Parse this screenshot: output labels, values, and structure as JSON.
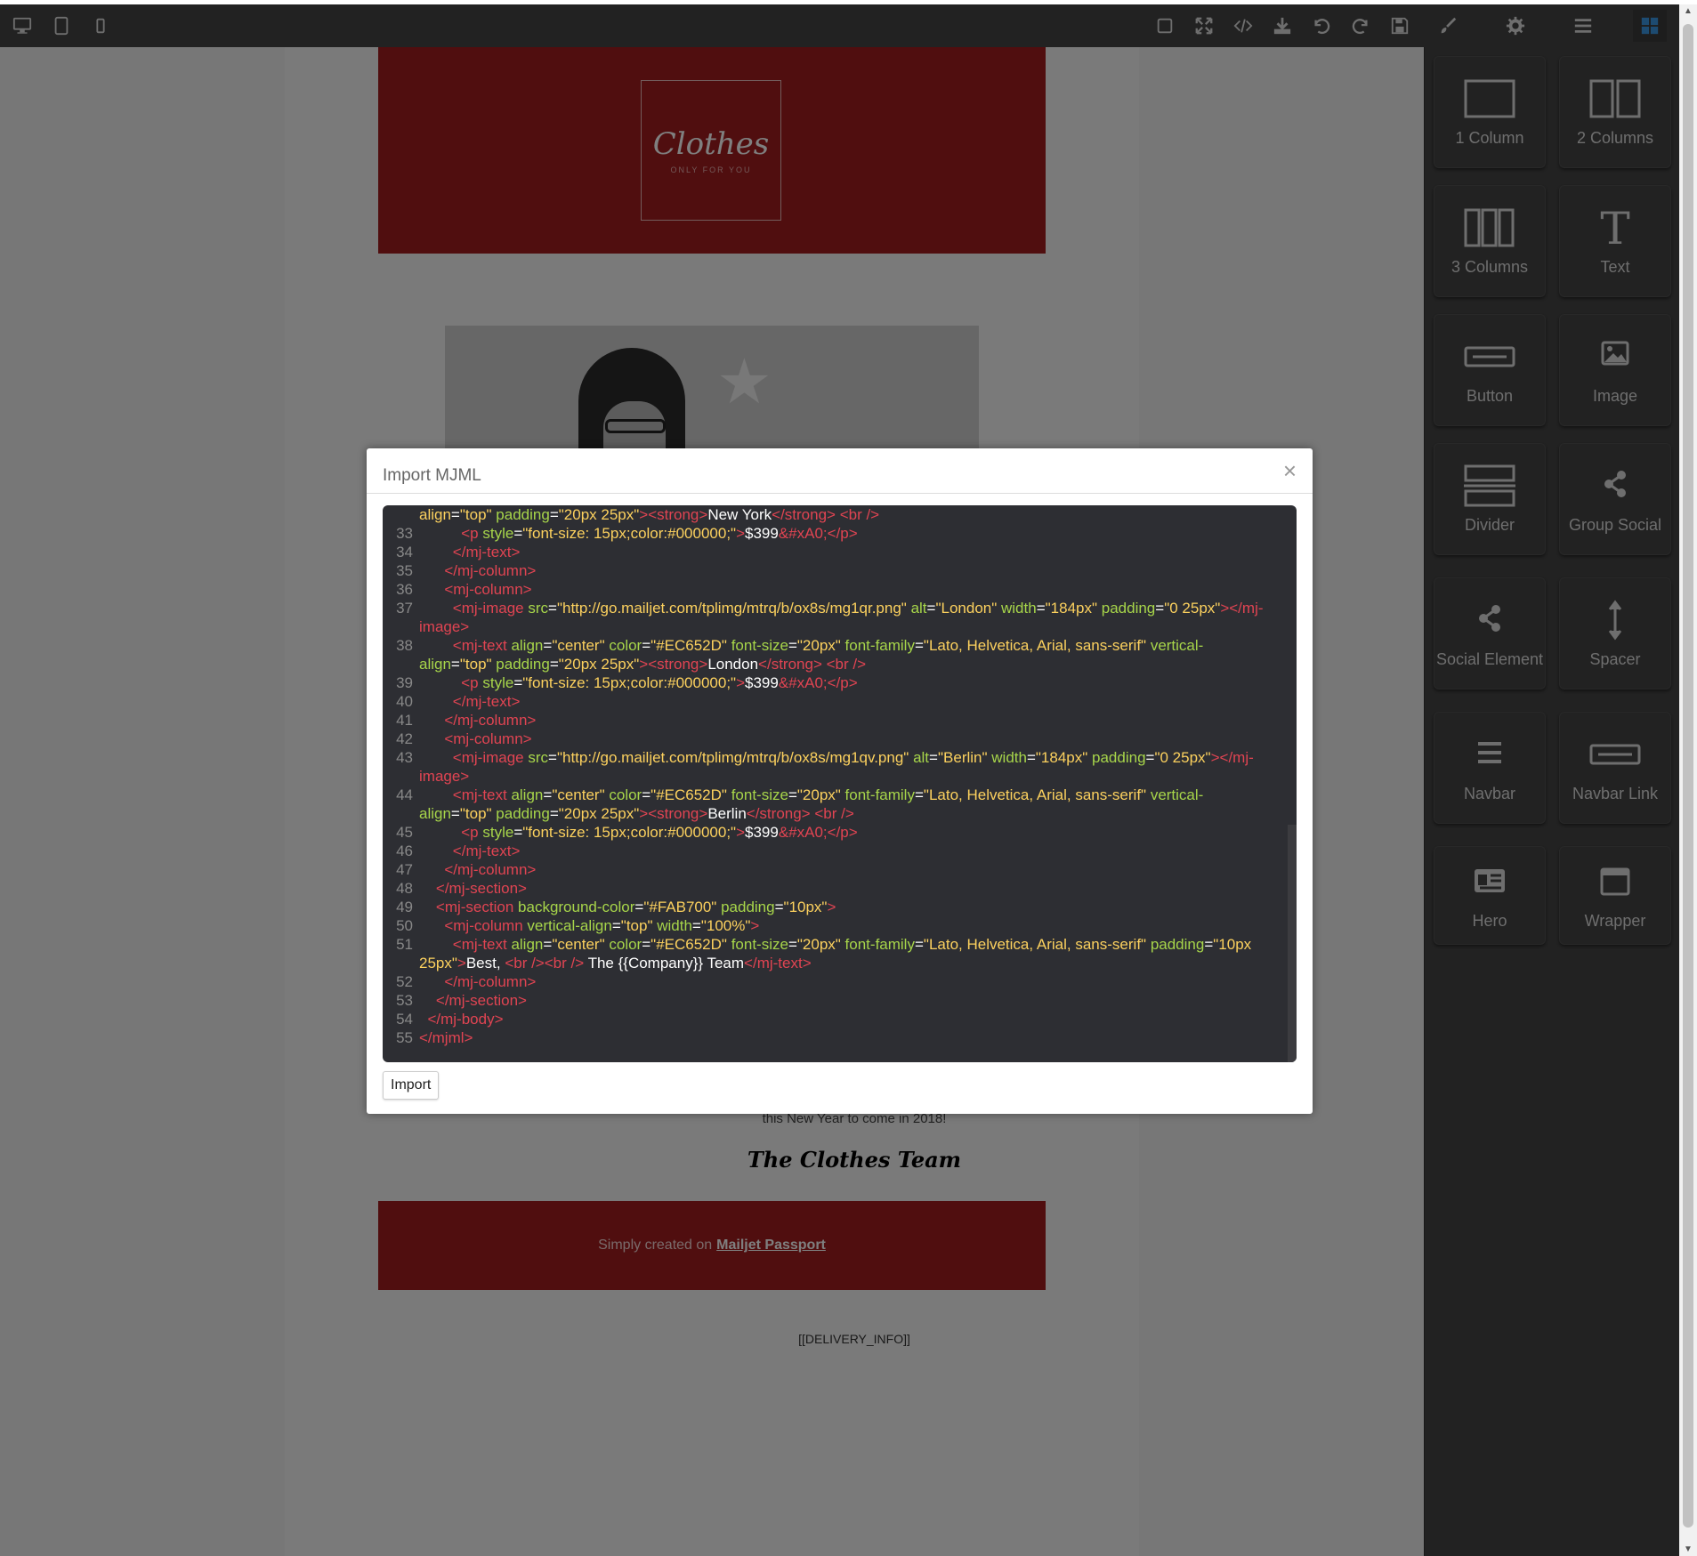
{
  "toolbar": {
    "devices": [
      "desktop-icon",
      "tablet-icon",
      "mobile-icon"
    ],
    "actions": [
      "square-icon",
      "fullscreen-icon",
      "code-icon",
      "download-icon",
      "undo-icon",
      "redo-icon",
      "save-icon"
    ],
    "panels": [
      "brush-icon",
      "gear-icon",
      "menu-icon",
      "blocks-icon"
    ]
  },
  "email": {
    "logo_text": "Clothes",
    "logo_sub": "ONLY FOR YOU",
    "partial_text": "this New Year to come in 2018!",
    "signature": "The Clothes Team",
    "footer_prefix": "Simply created on",
    "footer_link": "Mailjet Passport",
    "delivery": "[[DELIVERY_INFO]]"
  },
  "blocks": [
    {
      "label": "1 Column",
      "icon": "one-column-icon"
    },
    {
      "label": "2 Columns",
      "icon": "two-columns-icon"
    },
    {
      "label": "3 Columns",
      "icon": "three-columns-icon"
    },
    {
      "label": "Text",
      "icon": "text-icon"
    },
    {
      "label": "Button",
      "icon": "button-icon"
    },
    {
      "label": "Image",
      "icon": "image-icon"
    },
    {
      "label": "Divider",
      "icon": "divider-icon"
    },
    {
      "label": "Group Social",
      "icon": "share-icon"
    },
    {
      "label": "Social Element",
      "icon": "share-icon"
    },
    {
      "label": "Spacer",
      "icon": "spacer-icon"
    },
    {
      "label": "Navbar",
      "icon": "navbar-icon"
    },
    {
      "label": "Navbar Link",
      "icon": "navbar-link-icon"
    },
    {
      "label": "Hero",
      "icon": "hero-icon"
    },
    {
      "label": "Wrapper",
      "icon": "wrapper-icon"
    }
  ],
  "modal": {
    "title": "Import MJML",
    "close": "×",
    "import_button": "Import",
    "code_lines": [
      {
        "n": "",
        "parts": [
          [
            "s",
            "align"
          ],
          [
            "w",
            "="
          ],
          [
            "s",
            "\"top\""
          ],
          [
            "w",
            " "
          ],
          [
            "a",
            "padding"
          ],
          [
            "w",
            "="
          ],
          [
            "s",
            "\"20px 25px\""
          ],
          [
            "t",
            "><strong>"
          ],
          [
            "w",
            "New York"
          ],
          [
            "t",
            "</strong> <br />"
          ]
        ]
      },
      {
        "n": "33",
        "parts": [
          [
            "w",
            "          "
          ],
          [
            "t",
            "<p "
          ],
          [
            "a",
            "style"
          ],
          [
            "w",
            "="
          ],
          [
            "s",
            "\"font-size: 15px;color:#000000;\""
          ],
          [
            "t",
            ">"
          ],
          [
            "w",
            "$399"
          ],
          [
            "t",
            "&#xA0;</p>"
          ]
        ]
      },
      {
        "n": "34",
        "parts": [
          [
            "w",
            "        "
          ],
          [
            "t",
            "</mj-text>"
          ]
        ]
      },
      {
        "n": "35",
        "parts": [
          [
            "w",
            "      "
          ],
          [
            "t",
            "</mj-column>"
          ]
        ]
      },
      {
        "n": "36",
        "parts": [
          [
            "w",
            "      "
          ],
          [
            "t",
            "<mj-column>"
          ]
        ]
      },
      {
        "n": "37",
        "parts": [
          [
            "w",
            "        "
          ],
          [
            "t",
            "<mj-image "
          ],
          [
            "a",
            "src"
          ],
          [
            "w",
            "="
          ],
          [
            "s",
            "\"http://go.mailjet.com/tplimg/mtrq/b/ox8s/mg1qr.png\""
          ],
          [
            "w",
            " "
          ],
          [
            "a",
            "alt"
          ],
          [
            "w",
            "="
          ],
          [
            "s",
            "\"London\""
          ],
          [
            "w",
            " "
          ],
          [
            "a",
            "width"
          ],
          [
            "w",
            "="
          ],
          [
            "s",
            "\"184px\""
          ],
          [
            "w",
            " "
          ],
          [
            "a",
            "padding"
          ],
          [
            "w",
            "="
          ],
          [
            "s",
            "\"0 25px\""
          ],
          [
            "t",
            "></mj-image>"
          ]
        ]
      },
      {
        "n": "38",
        "parts": [
          [
            "w",
            "        "
          ],
          [
            "t",
            "<mj-text "
          ],
          [
            "a",
            "align"
          ],
          [
            "w",
            "="
          ],
          [
            "s",
            "\"center\""
          ],
          [
            "w",
            " "
          ],
          [
            "a",
            "color"
          ],
          [
            "w",
            "="
          ],
          [
            "s",
            "\"#EC652D\""
          ],
          [
            "w",
            " "
          ],
          [
            "a",
            "font-size"
          ],
          [
            "w",
            "="
          ],
          [
            "s",
            "\"20px\""
          ],
          [
            "w",
            " "
          ],
          [
            "a",
            "font-family"
          ],
          [
            "w",
            "="
          ],
          [
            "s",
            "\"Lato, Helvetica, Arial, sans-serif\""
          ],
          [
            "w",
            " "
          ],
          [
            "a",
            "vertical-align"
          ],
          [
            "w",
            "="
          ],
          [
            "s",
            "\"top\""
          ],
          [
            "w",
            " "
          ],
          [
            "a",
            "padding"
          ],
          [
            "w",
            "="
          ],
          [
            "s",
            "\"20px 25px\""
          ],
          [
            "t",
            "><strong>"
          ],
          [
            "w",
            "London"
          ],
          [
            "t",
            "</strong> <br />"
          ]
        ]
      },
      {
        "n": "39",
        "parts": [
          [
            "w",
            "          "
          ],
          [
            "t",
            "<p "
          ],
          [
            "a",
            "style"
          ],
          [
            "w",
            "="
          ],
          [
            "s",
            "\"font-size: 15px;color:#000000;\""
          ],
          [
            "t",
            ">"
          ],
          [
            "w",
            "$399"
          ],
          [
            "t",
            "&#xA0;</p>"
          ]
        ]
      },
      {
        "n": "40",
        "parts": [
          [
            "w",
            "        "
          ],
          [
            "t",
            "</mj-text>"
          ]
        ]
      },
      {
        "n": "41",
        "parts": [
          [
            "w",
            "      "
          ],
          [
            "t",
            "</mj-column>"
          ]
        ]
      },
      {
        "n": "42",
        "parts": [
          [
            "w",
            "      "
          ],
          [
            "t",
            "<mj-column>"
          ]
        ]
      },
      {
        "n": "43",
        "parts": [
          [
            "w",
            "        "
          ],
          [
            "t",
            "<mj-image "
          ],
          [
            "a",
            "src"
          ],
          [
            "w",
            "="
          ],
          [
            "s",
            "\"http://go.mailjet.com/tplimg/mtrq/b/ox8s/mg1qv.png\""
          ],
          [
            "w",
            " "
          ],
          [
            "a",
            "alt"
          ],
          [
            "w",
            "="
          ],
          [
            "s",
            "\"Berlin\""
          ],
          [
            "w",
            " "
          ],
          [
            "a",
            "width"
          ],
          [
            "w",
            "="
          ],
          [
            "s",
            "\"184px\""
          ],
          [
            "w",
            " "
          ],
          [
            "a",
            "padding"
          ],
          [
            "w",
            "="
          ],
          [
            "s",
            "\"0 25px\""
          ],
          [
            "t",
            "></mj-image>"
          ]
        ]
      },
      {
        "n": "44",
        "parts": [
          [
            "w",
            "        "
          ],
          [
            "t",
            "<mj-text "
          ],
          [
            "a",
            "align"
          ],
          [
            "w",
            "="
          ],
          [
            "s",
            "\"center\""
          ],
          [
            "w",
            " "
          ],
          [
            "a",
            "color"
          ],
          [
            "w",
            "="
          ],
          [
            "s",
            "\"#EC652D\""
          ],
          [
            "w",
            " "
          ],
          [
            "a",
            "font-size"
          ],
          [
            "w",
            "="
          ],
          [
            "s",
            "\"20px\""
          ],
          [
            "w",
            " "
          ],
          [
            "a",
            "font-family"
          ],
          [
            "w",
            "="
          ],
          [
            "s",
            "\"Lato, Helvetica, Arial, sans-serif\""
          ],
          [
            "w",
            " "
          ],
          [
            "a",
            "vertical-align"
          ],
          [
            "w",
            "="
          ],
          [
            "s",
            "\"top\""
          ],
          [
            "w",
            " "
          ],
          [
            "a",
            "padding"
          ],
          [
            "w",
            "="
          ],
          [
            "s",
            "\"20px 25px\""
          ],
          [
            "t",
            "><strong>"
          ],
          [
            "w",
            "Berlin"
          ],
          [
            "t",
            "</strong> <br />"
          ]
        ]
      },
      {
        "n": "45",
        "parts": [
          [
            "w",
            "          "
          ],
          [
            "t",
            "<p "
          ],
          [
            "a",
            "style"
          ],
          [
            "w",
            "="
          ],
          [
            "s",
            "\"font-size: 15px;color:#000000;\""
          ],
          [
            "t",
            ">"
          ],
          [
            "w",
            "$399"
          ],
          [
            "t",
            "&#xA0;</p>"
          ]
        ]
      },
      {
        "n": "46",
        "parts": [
          [
            "w",
            "        "
          ],
          [
            "t",
            "</mj-text>"
          ]
        ]
      },
      {
        "n": "47",
        "parts": [
          [
            "w",
            "      "
          ],
          [
            "t",
            "</mj-column>"
          ]
        ]
      },
      {
        "n": "48",
        "parts": [
          [
            "w",
            "    "
          ],
          [
            "t",
            "</mj-section>"
          ]
        ]
      },
      {
        "n": "49",
        "parts": [
          [
            "w",
            "    "
          ],
          [
            "t",
            "<mj-section "
          ],
          [
            "a",
            "background-color"
          ],
          [
            "w",
            "="
          ],
          [
            "s",
            "\"#FAB700\""
          ],
          [
            "w",
            " "
          ],
          [
            "a",
            "padding"
          ],
          [
            "w",
            "="
          ],
          [
            "s",
            "\"10px\""
          ],
          [
            "t",
            ">"
          ]
        ]
      },
      {
        "n": "50",
        "parts": [
          [
            "w",
            "      "
          ],
          [
            "t",
            "<mj-column "
          ],
          [
            "a",
            "vertical-align"
          ],
          [
            "w",
            "="
          ],
          [
            "s",
            "\"top\""
          ],
          [
            "w",
            " "
          ],
          [
            "a",
            "width"
          ],
          [
            "w",
            "="
          ],
          [
            "s",
            "\"100%\""
          ],
          [
            "t",
            ">"
          ]
        ]
      },
      {
        "n": "51",
        "parts": [
          [
            "w",
            "        "
          ],
          [
            "t",
            "<mj-text "
          ],
          [
            "a",
            "align"
          ],
          [
            "w",
            "="
          ],
          [
            "s",
            "\"center\""
          ],
          [
            "w",
            " "
          ],
          [
            "a",
            "color"
          ],
          [
            "w",
            "="
          ],
          [
            "s",
            "\"#EC652D\""
          ],
          [
            "w",
            " "
          ],
          [
            "a",
            "font-size"
          ],
          [
            "w",
            "="
          ],
          [
            "s",
            "\"20px\""
          ],
          [
            "w",
            " "
          ],
          [
            "a",
            "font-family"
          ],
          [
            "w",
            "="
          ],
          [
            "s",
            "\"Lato, Helvetica, Arial, sans-serif\""
          ],
          [
            "w",
            " "
          ],
          [
            "a",
            "padding"
          ],
          [
            "w",
            "="
          ],
          [
            "s",
            "\"10px 25px\""
          ],
          [
            "t",
            ">"
          ],
          [
            "w",
            "Best, "
          ],
          [
            "t",
            "<br /><br />"
          ],
          [
            "w",
            " The {{Company}} Team"
          ],
          [
            "t",
            "</mj-text>"
          ]
        ]
      },
      {
        "n": "52",
        "parts": [
          [
            "w",
            "      "
          ],
          [
            "t",
            "</mj-column>"
          ]
        ]
      },
      {
        "n": "53",
        "parts": [
          [
            "w",
            "    "
          ],
          [
            "t",
            "</mj-section>"
          ]
        ]
      },
      {
        "n": "54",
        "parts": [
          [
            "w",
            "  "
          ],
          [
            "t",
            "</mj-body>"
          ]
        ]
      },
      {
        "n": "55",
        "parts": [
          [
            "t",
            "</mjml>"
          ]
        ]
      }
    ]
  }
}
